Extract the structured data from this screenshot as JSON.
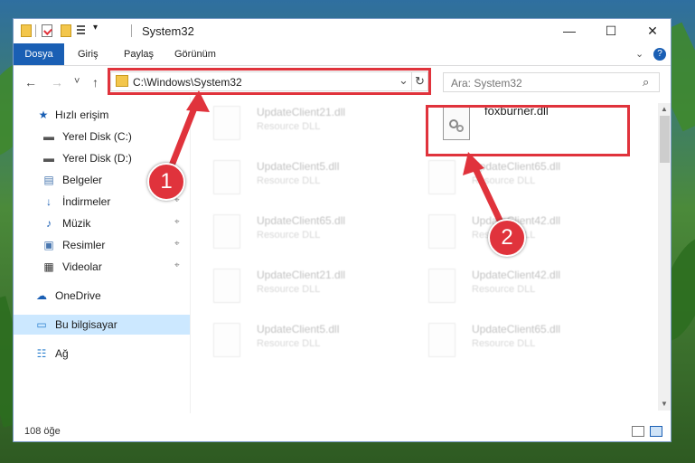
{
  "window": {
    "title": "System32",
    "minimize": "—",
    "maximize": "☐",
    "close": "✕"
  },
  "ribbon": {
    "tabs": [
      "Dosya",
      "Giriş",
      "Paylaş",
      "Görünüm"
    ],
    "expand": "⌄",
    "help": "?"
  },
  "address": {
    "path": "C:\\Windows\\System32",
    "back": "←",
    "forward": "→",
    "recent": "˅",
    "up": "↑",
    "refresh": "↻",
    "dropdown": "⌄"
  },
  "search": {
    "placeholder": "Ara: System32",
    "icon": "⌕"
  },
  "nav": {
    "items": [
      {
        "label": "Hızlı erişim",
        "icon": "star-icon",
        "glyph": "★"
      },
      {
        "label": "Yerel Disk (C:)",
        "icon": "drive-icon",
        "glyph": "▬"
      },
      {
        "label": "Yerel Disk (D:)",
        "icon": "drive-icon",
        "glyph": "▬"
      },
      {
        "label": "Belgeler",
        "icon": "document-icon",
        "glyph": "▤"
      },
      {
        "label": "İndirmeler",
        "icon": "download-icon",
        "glyph": "↓"
      },
      {
        "label": "Müzik",
        "icon": "music-icon",
        "glyph": "♪"
      },
      {
        "label": "Resimler",
        "icon": "pictures-icon",
        "glyph": "▣"
      },
      {
        "label": "Videolar",
        "icon": "video-icon",
        "glyph": "▦"
      },
      {
        "label": "OneDrive",
        "icon": "cloud-icon",
        "glyph": "☁"
      },
      {
        "label": "Bu bilgisayar",
        "icon": "computer-icon",
        "glyph": "▭"
      },
      {
        "label": "Ağ",
        "icon": "network-icon",
        "glyph": "☷"
      }
    ],
    "pin": "⌖"
  },
  "files": [
    {
      "name": "UpdateClient21.dll",
      "type": "Resource DLL"
    },
    {
      "name": "foxburner.dll",
      "type": ""
    },
    {
      "name": "UpdateClient5.dll",
      "type": "Resource DLL"
    },
    {
      "name": "UpdateClient65.dll",
      "type": "Resource DLL"
    },
    {
      "name": "UpdateClient65.dll",
      "type": "Resource DLL"
    },
    {
      "name": "UpdateClient42.dll",
      "type": "Resource DLL"
    },
    {
      "name": "UpdateClient21.dll",
      "type": "Resource DLL"
    },
    {
      "name": "UpdateClient42.dll",
      "type": "Resource DLL"
    },
    {
      "name": "UpdateClient5.dll",
      "type": "Resource DLL"
    },
    {
      "name": "UpdateClient65.dll",
      "type": "Resource DLL"
    }
  ],
  "status": {
    "count": "108 öğe"
  },
  "callouts": {
    "one": "1",
    "two": "2"
  },
  "colors": {
    "accent": "#1a5fb4",
    "callout": "#e0333c",
    "selection": "#cce8ff"
  }
}
